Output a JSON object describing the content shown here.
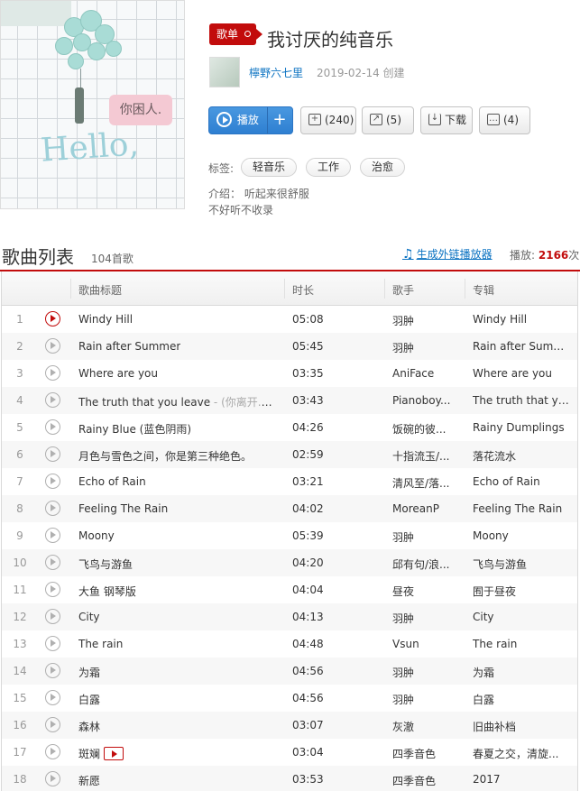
{
  "header": {
    "badge": "歌单",
    "title": "我讨厌的纯音乐",
    "creator": "檸野六七里",
    "created": "2019-02-14 创建",
    "cover_text_hello": "Hello,",
    "cover_bubble": "你困人.",
    "buttons": {
      "play": "播放",
      "play_add": "+",
      "fav": "(240)",
      "share": "(5)",
      "download": "下载",
      "comment": "(4)"
    },
    "tags_label": "标签:",
    "tags": [
      "轻音乐",
      "工作",
      "治愈"
    ],
    "intro_line1": "介绍：  听起来很舒服",
    "intro_line2": "不好听不收录"
  },
  "list": {
    "title": "歌曲列表",
    "count": "104首歌",
    "gen_link": "生成外链播放器",
    "play_label": "播放:",
    "play_count": "2166",
    "play_unit": "次",
    "columns": [
      "歌曲标题",
      "时长",
      "歌手",
      "专辑"
    ]
  },
  "songs": [
    {
      "idx": "1",
      "title": "Windy Hill",
      "sub": "",
      "mv": false,
      "time": "05:08",
      "artist": "羽肿",
      "album": "Windy Hill",
      "active": true
    },
    {
      "idx": "2",
      "title": "Rain after Summer",
      "sub": "",
      "mv": false,
      "time": "05:45",
      "artist": "羽肿",
      "album": "Rain after Summer",
      "active": false
    },
    {
      "idx": "3",
      "title": "Where are you",
      "sub": "",
      "mv": false,
      "time": "03:35",
      "artist": "AniFace",
      "album": "Where are you",
      "active": false
    },
    {
      "idx": "4",
      "title": "The truth that you leave",
      "sub": " - (你离开...",
      "mv": true,
      "time": "03:43",
      "artist": "Pianoboy...",
      "album": "The truth that you...",
      "active": false
    },
    {
      "idx": "5",
      "title": "Rainy Blue (蓝色阴雨)",
      "sub": "",
      "mv": false,
      "time": "04:26",
      "artist": "饭碗的彼...",
      "album": "Rainy Dumplings",
      "active": false
    },
    {
      "idx": "6",
      "title": "月色与雪色之间，你是第三种绝色。",
      "sub": "",
      "mv": false,
      "time": "02:59",
      "artist": "十指流玉/...",
      "album": "落花流水",
      "active": false
    },
    {
      "idx": "7",
      "title": "Echo of Rain",
      "sub": "",
      "mv": false,
      "time": "03:21",
      "artist": "清风至/落...",
      "album": "Echo of Rain",
      "active": false
    },
    {
      "idx": "8",
      "title": "Feeling The Rain",
      "sub": "",
      "mv": false,
      "time": "04:02",
      "artist": "MoreanP",
      "album": "Feeling The Rain",
      "active": false
    },
    {
      "idx": "9",
      "title": "Moony",
      "sub": "",
      "mv": false,
      "time": "05:39",
      "artist": "羽肿",
      "album": "Moony",
      "active": false
    },
    {
      "idx": "10",
      "title": "飞鸟与游鱼",
      "sub": "",
      "mv": false,
      "time": "04:20",
      "artist": "邱有句/浪...",
      "album": "飞鸟与游鱼",
      "active": false
    },
    {
      "idx": "11",
      "title": "大鱼 钢琴版",
      "sub": "",
      "mv": false,
      "time": "04:04",
      "artist": "昼夜",
      "album": "囿于昼夜",
      "active": false
    },
    {
      "idx": "12",
      "title": "City",
      "sub": "",
      "mv": false,
      "time": "04:13",
      "artist": "羽肿",
      "album": "City",
      "active": false
    },
    {
      "idx": "13",
      "title": "The rain",
      "sub": "",
      "mv": false,
      "time": "04:48",
      "artist": "Vsun",
      "album": "The rain",
      "active": false
    },
    {
      "idx": "14",
      "title": "为霜",
      "sub": "",
      "mv": false,
      "time": "04:56",
      "artist": "羽肿",
      "album": "为霜",
      "active": false
    },
    {
      "idx": "15",
      "title": "白露",
      "sub": "",
      "mv": false,
      "time": "04:56",
      "artist": "羽肿",
      "album": "白露",
      "active": false
    },
    {
      "idx": "16",
      "title": "森林",
      "sub": "",
      "mv": false,
      "time": "03:07",
      "artist": "灰澈",
      "album": "旧曲补档",
      "active": false
    },
    {
      "idx": "17",
      "title": "斑斓",
      "sub": "",
      "mv": true,
      "time": "03:04",
      "artist": "四季音色",
      "album": "春夏之交，清旋...",
      "active": false
    },
    {
      "idx": "18",
      "title": "新愿",
      "sub": "",
      "mv": false,
      "time": "03:53",
      "artist": "四季音色",
      "album": "2017",
      "active": false
    }
  ]
}
